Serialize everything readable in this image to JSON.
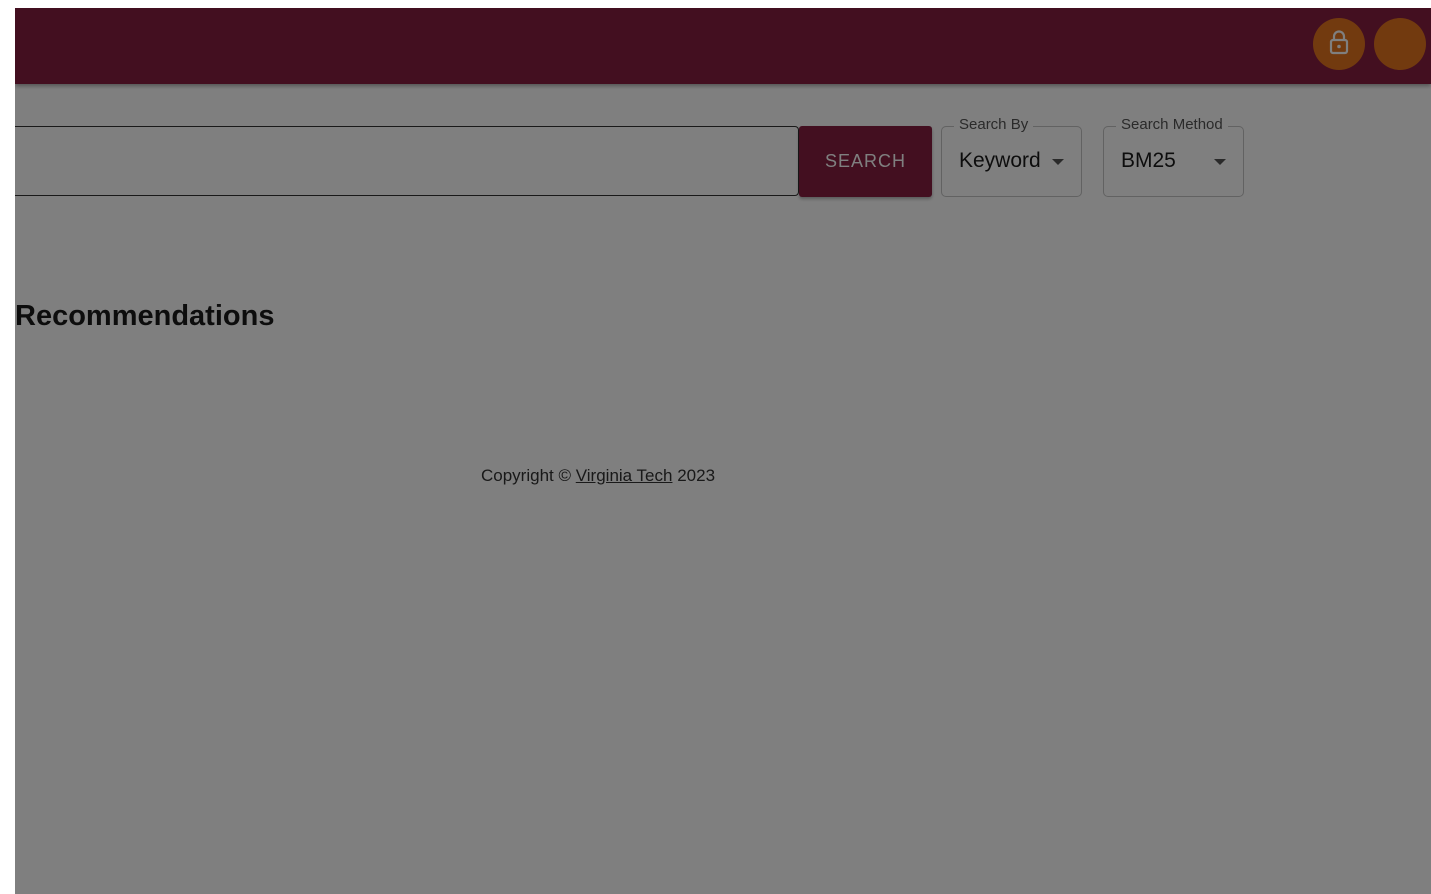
{
  "header": {
    "lock_icon": "lock-icon",
    "avatar_color": "#e5751f",
    "bar_color": "#861f41"
  },
  "search": {
    "button_label": "SEARCH",
    "query_value": ""
  },
  "search_by": {
    "label": "Search By",
    "value": "Keyword"
  },
  "search_method": {
    "label": "Search Method",
    "value": "BM25"
  },
  "main": {
    "section_title": "Recommendations"
  },
  "footer": {
    "prefix": "Copyright ©",
    "link_text": "Virginia Tech",
    "year": "2023"
  }
}
